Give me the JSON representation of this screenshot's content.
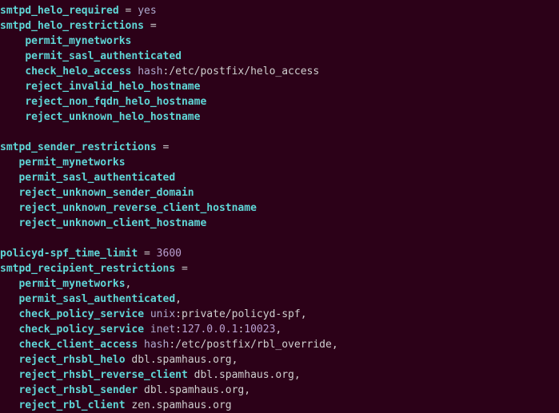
{
  "lines": [
    {
      "ind": "",
      "t": [
        [
          "kw",
          "smtpd_helo_required"
        ],
        [
          "plain",
          " "
        ],
        [
          "op",
          "="
        ],
        [
          "plain",
          " "
        ],
        [
          "val",
          "yes"
        ]
      ]
    },
    {
      "ind": "",
      "t": [
        [
          "kw",
          "smtpd_helo_restrictions"
        ],
        [
          "plain",
          " "
        ],
        [
          "op",
          "="
        ]
      ]
    },
    {
      "ind": "    ",
      "t": [
        [
          "kw",
          "permit_mynetworks"
        ]
      ]
    },
    {
      "ind": "    ",
      "t": [
        [
          "kw",
          "permit_sasl_authenticated"
        ]
      ]
    },
    {
      "ind": "    ",
      "t": [
        [
          "kw",
          "check_helo_access"
        ],
        [
          "plain",
          " "
        ],
        [
          "val",
          "hash"
        ],
        [
          "plain",
          ":/etc/postfix/helo_access"
        ]
      ]
    },
    {
      "ind": "    ",
      "t": [
        [
          "kw",
          "reject_invalid_helo_hostname"
        ]
      ]
    },
    {
      "ind": "    ",
      "t": [
        [
          "kw",
          "reject_non_fqdn_helo_hostname"
        ]
      ]
    },
    {
      "ind": "    ",
      "t": [
        [
          "kw",
          "reject_unknown_helo_hostname"
        ]
      ]
    },
    {
      "ind": "",
      "t": []
    },
    {
      "ind": "",
      "t": [
        [
          "kw",
          "smtpd_sender_restrictions"
        ],
        [
          "plain",
          " "
        ],
        [
          "op",
          "="
        ]
      ]
    },
    {
      "ind": "   ",
      "t": [
        [
          "kw",
          "permit_mynetworks"
        ]
      ]
    },
    {
      "ind": "   ",
      "t": [
        [
          "kw",
          "permit_sasl_authenticated"
        ]
      ]
    },
    {
      "ind": "   ",
      "t": [
        [
          "kw",
          "reject_unknown_sender_domain"
        ]
      ]
    },
    {
      "ind": "   ",
      "t": [
        [
          "kw",
          "reject_unknown_reverse_client_hostname"
        ]
      ]
    },
    {
      "ind": "   ",
      "t": [
        [
          "kw",
          "reject_unknown_client_hostname"
        ]
      ]
    },
    {
      "ind": "",
      "t": []
    },
    {
      "ind": "",
      "t": [
        [
          "kw",
          "policyd-spf_time_limit"
        ],
        [
          "plain",
          " "
        ],
        [
          "op",
          "="
        ],
        [
          "plain",
          " "
        ],
        [
          "num",
          "3600"
        ]
      ]
    },
    {
      "ind": "",
      "t": [
        [
          "kw",
          "smtpd_recipient_restrictions"
        ],
        [
          "plain",
          " "
        ],
        [
          "op",
          "="
        ]
      ]
    },
    {
      "ind": "   ",
      "t": [
        [
          "kw",
          "permit_mynetworks"
        ],
        [
          "plain",
          ","
        ]
      ]
    },
    {
      "ind": "   ",
      "t": [
        [
          "kw",
          "permit_sasl_authenticated"
        ],
        [
          "plain",
          ","
        ]
      ]
    },
    {
      "ind": "   ",
      "t": [
        [
          "kw",
          "check_policy_service"
        ],
        [
          "plain",
          " "
        ],
        [
          "val",
          "unix"
        ],
        [
          "plain",
          ":private/policyd-spf,"
        ]
      ]
    },
    {
      "ind": "   ",
      "t": [
        [
          "kw",
          "check_policy_service"
        ],
        [
          "plain",
          " "
        ],
        [
          "val",
          "inet"
        ],
        [
          "plain",
          ":"
        ],
        [
          "num",
          "127.0.0.1"
        ],
        [
          "plain",
          ":"
        ],
        [
          "num",
          "10023"
        ],
        [
          "plain",
          ","
        ]
      ]
    },
    {
      "ind": "   ",
      "t": [
        [
          "kw",
          "check_client_access"
        ],
        [
          "plain",
          " "
        ],
        [
          "val",
          "hash"
        ],
        [
          "plain",
          ":/etc/postfix/rbl_override,"
        ]
      ]
    },
    {
      "ind": "   ",
      "t": [
        [
          "kw",
          "reject_rhsbl_helo"
        ],
        [
          "plain",
          " dbl.spamhaus.org,"
        ]
      ]
    },
    {
      "ind": "   ",
      "t": [
        [
          "kw",
          "reject_rhsbl_reverse_client"
        ],
        [
          "plain",
          " dbl.spamhaus.org,"
        ]
      ]
    },
    {
      "ind": "   ",
      "t": [
        [
          "kw",
          "reject_rhsbl_sender"
        ],
        [
          "plain",
          " dbl.spamhaus.org,"
        ]
      ]
    },
    {
      "ind": "   ",
      "t": [
        [
          "kw",
          "reject_rbl_client"
        ],
        [
          "plain",
          " zen.spamhaus.org"
        ]
      ]
    }
  ]
}
